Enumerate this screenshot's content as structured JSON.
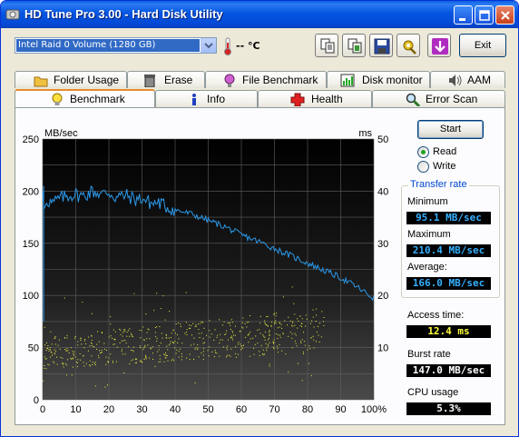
{
  "window": {
    "title": "HD Tune Pro 3.00 - Hard Disk Utility"
  },
  "drive_select": {
    "value": "Intel    Raid 0 Volume (1280 GB)"
  },
  "temperature": {
    "value": "-- °C"
  },
  "toolbar": {
    "icons": [
      "copy-text-icon",
      "copy-screenshot-icon",
      "save-icon",
      "options-icon",
      "download-icon"
    ],
    "exit_label": "Exit"
  },
  "tabs": {
    "row1": [
      {
        "label": "Folder Usage",
        "icon": "folder-icon"
      },
      {
        "label": "Erase",
        "icon": "trash-icon"
      },
      {
        "label": "File Benchmark",
        "icon": "file-benchmark-icon"
      },
      {
        "label": "Disk monitor",
        "icon": "disk-monitor-icon"
      },
      {
        "label": "AAM",
        "icon": "speaker-icon"
      }
    ],
    "row2": [
      {
        "label": "Benchmark",
        "icon": "lightbulb-icon",
        "active": true
      },
      {
        "label": "Info",
        "icon": "info-icon"
      },
      {
        "label": "Health",
        "icon": "health-cross-icon"
      },
      {
        "label": "Error Scan",
        "icon": "magnifier-icon"
      }
    ]
  },
  "controls": {
    "start_label": "Start",
    "read_label": "Read",
    "write_label": "Write",
    "selected": "Read"
  },
  "transfer_rate": {
    "group_label": "Transfer rate",
    "minimum_label": "Minimum",
    "minimum_value": "95.1 MB/sec",
    "maximum_label": "Maximum",
    "maximum_value": "210.4 MB/sec",
    "average_label": "Average:",
    "average_value": "166.0 MB/sec"
  },
  "access_time": {
    "label": "Access time:",
    "value": "12.4 ms"
  },
  "burst_rate": {
    "label": "Burst rate",
    "value": "147.0 MB/sec"
  },
  "cpu_usage": {
    "label": "CPU usage",
    "value": "5.3%"
  },
  "colors": {
    "rate_line": "#2b98e8",
    "access_points": "#f0f040",
    "plot_bg": "#000000",
    "grid": "#606060"
  },
  "chart_data": {
    "type": "line",
    "title": "",
    "xlabel": "",
    "ylabel": "MB/sec",
    "y2label": "ms",
    "xlim": [
      0,
      100
    ],
    "ylim": [
      0,
      250
    ],
    "y2lim": [
      0,
      50
    ],
    "x_ticks": [
      "0",
      "10",
      "20",
      "30",
      "40",
      "50",
      "60",
      "70",
      "80",
      "90",
      "100%"
    ],
    "y_ticks": [
      "0",
      "50",
      "100",
      "150",
      "200",
      "250"
    ],
    "y2_ticks": [
      "10",
      "20",
      "30",
      "40",
      "50"
    ],
    "grid": true,
    "series": [
      {
        "name": "",
        "axis": "left",
        "x": [
          0,
          0.5,
          1,
          3,
          5,
          8,
          10,
          12,
          15,
          18,
          20,
          22,
          25,
          28,
          30,
          33,
          35,
          38,
          40,
          45,
          50,
          55,
          60,
          65,
          70,
          75,
          80,
          85,
          90,
          95,
          100
        ],
        "y": [
          200,
          178,
          192,
          188,
          193,
          196,
          197,
          195,
          200,
          197,
          199,
          194,
          196,
          192,
          193,
          188,
          189,
          184,
          182,
          178,
          172,
          166,
          158,
          152,
          145,
          138,
          131,
          124,
          117,
          108,
          97
        ]
      }
    ],
    "scatter_series": {
      "name": "",
      "axis": "right",
      "x_range": [
        0,
        85
      ],
      "y_range_ms": [
        2,
        22
      ],
      "typical_ms": [
        8,
        17
      ],
      "count": 600
    }
  }
}
